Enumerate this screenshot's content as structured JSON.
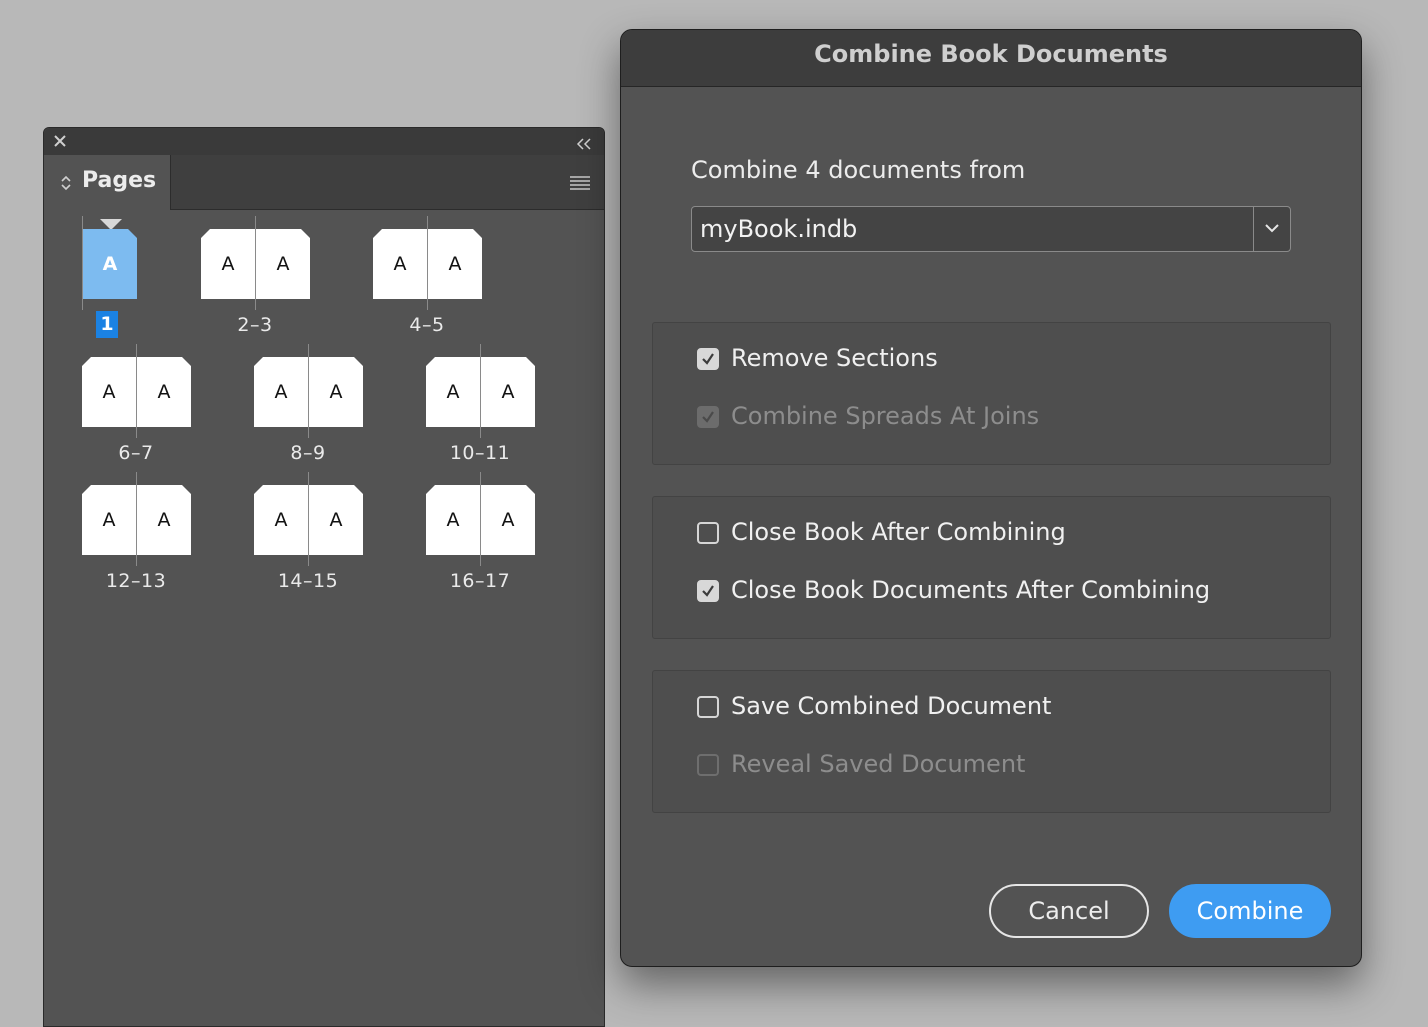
{
  "pages_panel": {
    "tab_label": "Pages",
    "current_page_label": "1",
    "spreads": [
      {
        "label": "2–3",
        "pages": [
          "A",
          "A"
        ]
      },
      {
        "label": "4–5",
        "pages": [
          "A",
          "A"
        ]
      },
      {
        "label": "6–7",
        "pages": [
          "A",
          "A"
        ]
      },
      {
        "label": "8–9",
        "pages": [
          "A",
          "A"
        ]
      },
      {
        "label": "10–11",
        "pages": [
          "A",
          "A"
        ]
      },
      {
        "label": "12–13",
        "pages": [
          "A",
          "A"
        ]
      },
      {
        "label": "14–15",
        "pages": [
          "A",
          "A"
        ]
      },
      {
        "label": "16–17",
        "pages": [
          "A",
          "A"
        ]
      }
    ],
    "first_page_master": "A",
    "selected_color": "#7dbbf0",
    "icons": [
      "close-icon",
      "collapse-icon",
      "expand-collapse-chevron-icon",
      "panel-menu-icon",
      "current-page-marker-icon"
    ]
  },
  "dialog": {
    "title": "Combine Book Documents",
    "combine_from_label": "Combine 4 documents from",
    "book_select": {
      "value": "myBook.indb"
    },
    "options": {
      "remove_sections": {
        "label": "Remove Sections",
        "checked": true,
        "enabled": true
      },
      "combine_spreads": {
        "label": "Combine Spreads At Joins",
        "checked": true,
        "enabled": false
      },
      "close_book": {
        "label": "Close Book After Combining",
        "checked": false,
        "enabled": true
      },
      "close_book_docs": {
        "label": "Close Book Documents After Combining",
        "checked": true,
        "enabled": true
      },
      "save_combined": {
        "label": "Save Combined Document",
        "checked": false,
        "enabled": true
      },
      "reveal_saved": {
        "label": "Reveal Saved Document",
        "checked": false,
        "enabled": false
      }
    },
    "buttons": {
      "cancel": "Cancel",
      "combine": "Combine"
    },
    "accent_color": "#3e9cf2"
  }
}
